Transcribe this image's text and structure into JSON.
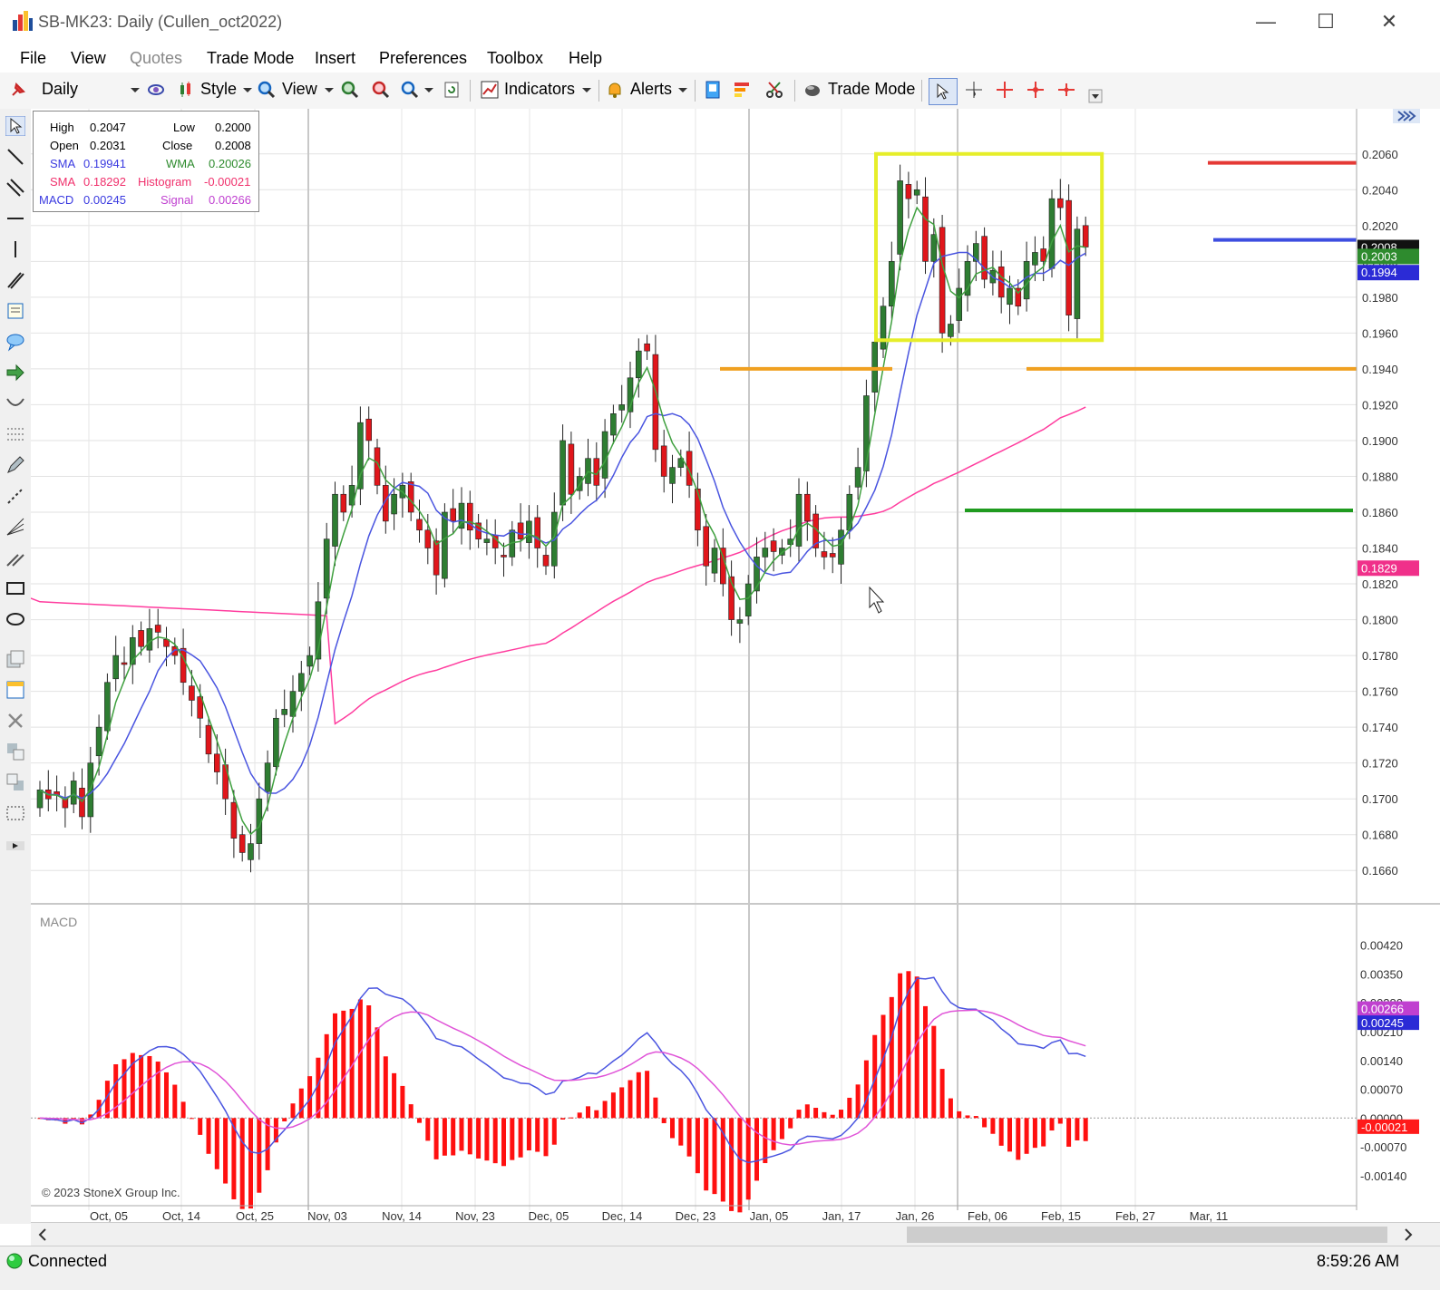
{
  "window": {
    "title": "SB-MK23: Daily (Cullen_oct2022)",
    "minimize": "—",
    "maximize": "☐",
    "close": "✕"
  },
  "menu": [
    "File",
    "View",
    "Quotes",
    "Trade Mode",
    "Insert",
    "Preferences",
    "Toolbox",
    "Help"
  ],
  "toolbar": {
    "period": "Daily",
    "style": "Style",
    "view": "View",
    "indicators": "Indicators",
    "alerts": "Alerts",
    "trade_mode": "Trade Mode"
  },
  "info": {
    "high_label": "High",
    "high": "0.2047",
    "low_label": "Low",
    "low": "0.2000",
    "open_label": "Open",
    "open": "0.2031",
    "close_label": "Close",
    "close": "0.2008",
    "sma1_label": "SMA",
    "sma1": "0.19941",
    "wma_label": "WMA",
    "wma": "0.20026",
    "sma2_label": "SMA",
    "sma2": "0.18292",
    "hist_label": "Histogram",
    "hist": "-0.00021",
    "macd_label": "MACD",
    "macd": "0.00245",
    "signal_label": "Signal",
    "signal": "0.00266"
  },
  "macd_panel_label": "MACD",
  "copyright": "© 2023 StoneX Group Inc.",
  "status": {
    "connection": "Connected",
    "time": "8:59:26 AM"
  },
  "colors": {
    "up": "#2e7d32",
    "down": "#e0161b",
    "sma_fast": "#4a55e0",
    "wma": "#3fa03f",
    "sma_slow": "#ff3c9e",
    "macd_line": "#4a55e0",
    "signal_line": "#e055d8",
    "histogram": "#ff1010",
    "highlight": "#e6ee2a"
  },
  "chart_data": [
    {
      "type": "candlestick",
      "price_ylim": [
        0.165,
        0.207
      ],
      "price_ticks": [
        "0.1660",
        "0.1680",
        "0.1700",
        "0.1720",
        "0.1740",
        "0.1760",
        "0.1780",
        "0.1800",
        "0.1820",
        "0.1840",
        "0.1860",
        "0.1880",
        "0.1900",
        "0.1920",
        "0.1940",
        "0.1960",
        "0.1980",
        "0.2000",
        "0.2020",
        "0.2040",
        "0.2060"
      ],
      "x_labels": [
        "Oct, 05",
        "Oct, 14",
        "Oct, 25",
        "Nov, 03",
        "Nov, 14",
        "Nov, 23",
        "Dec, 05",
        "Dec, 14",
        "Dec, 23",
        "Jan, 05",
        "Jan, 17",
        "Jan, 26",
        "Feb, 06",
        "Feb, 15",
        "Feb, 27",
        "Mar, 11"
      ],
      "closes": [
        0.1705,
        0.17,
        0.1702,
        0.1695,
        0.171,
        0.169,
        0.172,
        0.174,
        0.1765,
        0.178,
        0.1775,
        0.179,
        0.1785,
        0.1795,
        0.1793,
        0.1785,
        0.178,
        0.1765,
        0.1755,
        0.1745,
        0.1725,
        0.1715,
        0.17,
        0.1678,
        0.167,
        0.1675,
        0.17,
        0.172,
        0.1745,
        0.175,
        0.176,
        0.177,
        0.178,
        0.181,
        0.1845,
        0.187,
        0.186,
        0.1875,
        0.191,
        0.19,
        0.1875,
        0.1855,
        0.187,
        0.1875,
        0.186,
        0.185,
        0.184,
        0.1825,
        0.186,
        0.1855,
        0.1865,
        0.185,
        0.1845,
        0.1845,
        0.184,
        0.1835,
        0.185,
        0.1845,
        0.1855,
        0.184,
        0.183,
        0.186,
        0.19,
        0.187,
        0.188,
        0.189,
        0.1875,
        0.1905,
        0.1915,
        0.192,
        0.1935,
        0.195,
        0.195,
        0.1895,
        0.188,
        0.1885,
        0.189,
        0.1875,
        0.185,
        0.183,
        0.184,
        0.182,
        0.18,
        0.18,
        0.182,
        0.1835,
        0.184,
        0.1838,
        0.184,
        0.1845,
        0.187,
        0.1855,
        0.184,
        0.1835,
        0.1835,
        0.185,
        0.187,
        0.1885,
        0.1925,
        0.1955,
        0.1975,
        0.2,
        0.2045,
        0.2035,
        0.204,
        0.2,
        0.2015,
        0.196,
        0.1965,
        0.1985,
        0.2,
        0.201,
        0.199,
        0.1995,
        0.198,
        0.1985,
        0.1975,
        0.2,
        0.2005,
        0.2,
        0.2035,
        0.203,
        0.197,
        0.2018,
        0.2008
      ],
      "overlays": [
        {
          "name": "SMA",
          "value": "0.19941"
        },
        {
          "name": "WMA",
          "value": "0.20026"
        },
        {
          "name": "SMA",
          "value": "0.18292"
        }
      ],
      "axis_tags": [
        "0.2008",
        "0.2003",
        "0.1994",
        "0.1829"
      ],
      "horizontal_lines": [
        0.2055,
        0.2012,
        0.194,
        0.194,
        0.1861
      ]
    },
    {
      "type": "bar+line",
      "name": "MACD",
      "ticks": [
        "0.00420",
        "0.00350",
        "0.00280",
        "0.00210",
        "0.00140",
        "0.00070",
        "0.00000",
        "-0.00070",
        "-0.00140"
      ],
      "axis_tags": [
        "0.00266",
        "0.00245",
        "-0.00021"
      ]
    }
  ]
}
